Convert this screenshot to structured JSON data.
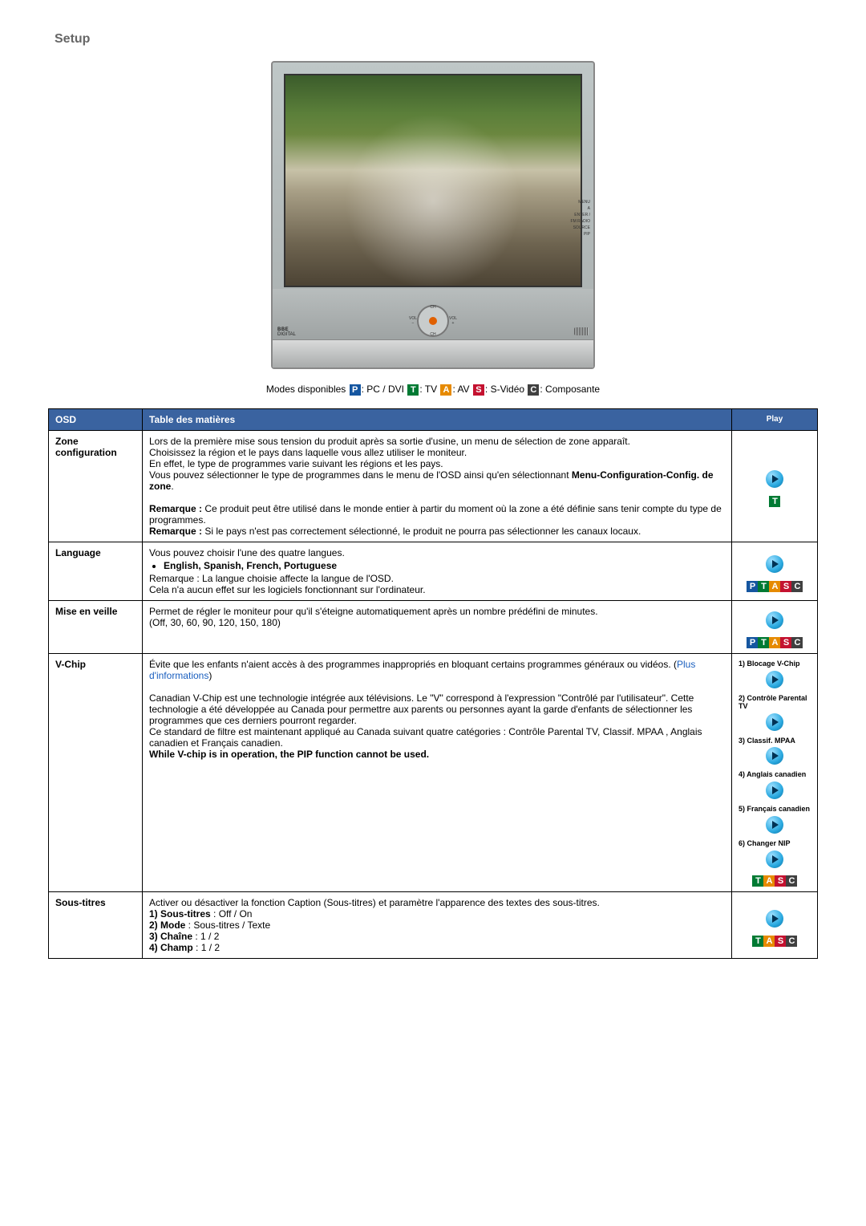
{
  "title": "Setup",
  "tv_image": {
    "side_labels": [
      "MENU",
      "A",
      "ENTER /",
      "FM RADIO",
      "SOURCE",
      "PIP",
      ""
    ],
    "controls": {
      "ch": "CH",
      "vol_minus": "VOL\n−",
      "vol_plus": "VOL\n+",
      "brand": "BBE",
      "brand_sub": "DIGITAL"
    }
  },
  "modes_line": {
    "prefix": "Modes disponibles ",
    "items": [
      {
        "badge": "P",
        "label": ": PC / DVI "
      },
      {
        "badge": "T",
        "label": ": TV "
      },
      {
        "badge": "A",
        "label": ": AV "
      },
      {
        "badge": "S",
        "label": ": S-Vidéo "
      },
      {
        "badge": "C",
        "label": ": Composante"
      }
    ]
  },
  "table": {
    "headers": {
      "osd": "OSD",
      "toc": "Table des matières",
      "play": "Play"
    },
    "rows": [
      {
        "osd": "Zone configuration",
        "toc_html": "Lors de la première mise sous tension du produit après sa sortie d'usine, un menu de sélection de zone apparaît.\nChoisissez la région et le pays dans laquelle vous allez utiliser le moniteur.\nEn effet, le type de programmes varie suivant les régions et les pays.\nVous pouvez sélectionner le type de programmes dans le menu de l'OSD ainsi qu'en sélectionnant <b>Menu-Configuration-Config. de zone</b>.\n\n<b>Remarque :</b> Ce produit peut être utilisé dans le monde entier à partir du moment où la zone a été définie sans tenir compte du type de programmes.\n<b>Remarque :</b> Si le pays n'est pas correctement sélectionné, le produit ne pourra pas sélectionner les canaux locaux.",
        "play": {
          "type": "single",
          "badges": "T"
        }
      },
      {
        "osd": "Language",
        "toc_html": "Vous pouvez choisir l'une des quatre langues.\n<ul class='lang'><li>English, Spanish, French, Portuguese</li></ul>Remarque : La langue choisie affecte la langue de l'OSD.\nCela n'a aucun effet sur les logiciels fonctionnant sur l'ordinateur.",
        "play": {
          "type": "single",
          "badges": "PTASC"
        }
      },
      {
        "osd": "Mise en veille",
        "toc_html": "Permet de régler le moniteur pour qu'il s'éteigne automatiquement après un nombre prédéfini de minutes.\n(Off, 30, 60, 90, 120, 150, 180)",
        "play": {
          "type": "single",
          "badges": "PTASC"
        }
      },
      {
        "osd": "V-Chip",
        "toc_html": "Évite que les enfants n'aient accès à des programmes inappropriés en bloquant certains programmes généraux ou vidéos. (<span class='link'>Plus d'informations</span>)\n\nCanadian V-Chip est une technologie intégrée aux télévisions. Le \"V\" correspond à l'expression \"Contrôlé par l'utilisateur\". Cette technologie a été développée au Canada pour permettre aux parents ou personnes ayant la garde d'enfants de sélectionner les programmes que ces derniers pourront regarder.\nCe standard de filtre est maintenant appliqué au Canada suivant quatre catégories : Contrôle Parental TV, Classif. MPAA , Anglais canadien et Français canadien.\n<b>While V-chip is in operation, the PIP function cannot be used.</b>",
        "play": {
          "type": "vchip",
          "items": [
            {
              "label": "1) Blocage V-Chip"
            },
            {
              "label": "2) Contrôle Parental TV"
            },
            {
              "label": "3) Classif. MPAA"
            },
            {
              "label": "4) Anglais canadien"
            },
            {
              "label": "5) Français canadien"
            },
            {
              "label": "6) Changer NIP"
            }
          ],
          "badges": "TASC"
        }
      },
      {
        "osd": "Sous-titres",
        "toc_html": "Activer ou désactiver la fonction Caption (Sous-titres) et paramètre l'apparence des textes des sous-titres.\n<b>1) Sous-titres</b> : Off / On\n<b>2) Mode</b> : Sous-titres / Texte\n<b>3) Chaîne</b> : 1 / 2\n<b>4) Champ</b> : 1 / 2",
        "play": {
          "type": "single",
          "badges": "TASC"
        }
      }
    ]
  }
}
